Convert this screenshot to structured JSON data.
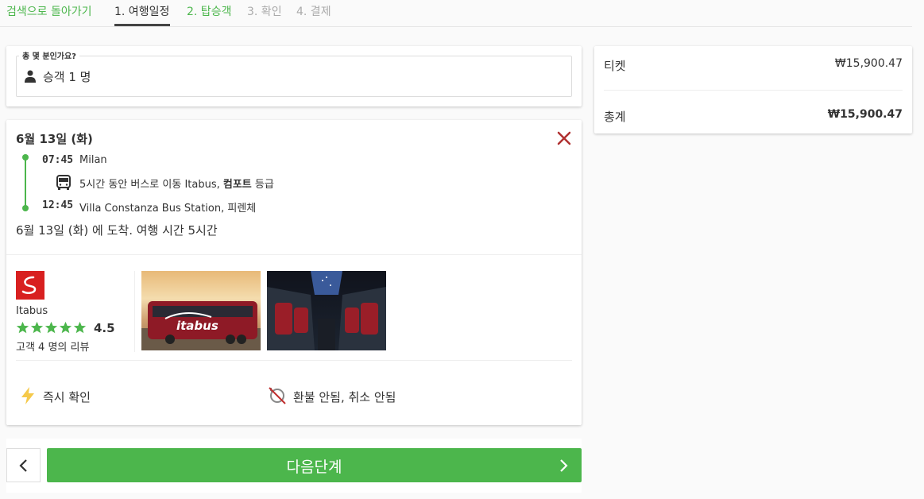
{
  "nav": {
    "back_label": "검색으로 돌아가기",
    "steps": [
      {
        "label": "1. 여행일정"
      },
      {
        "label": "2. 탑승객"
      },
      {
        "label": "3. 확인"
      },
      {
        "label": "4. 결제"
      }
    ]
  },
  "passengers": {
    "legend": "총 몇 분인가요?",
    "value": "승객 1 명"
  },
  "trip": {
    "date": "6월 13일 (화)",
    "departure": {
      "time": "07:45",
      "place": "Milan"
    },
    "segment": {
      "text": "5시간 동안 버스로 이동 Itabus, ",
      "class": "컴포트",
      "suffix": " 등급"
    },
    "arrival": {
      "time": "12:45",
      "place": "Villa Constanza Bus Station, 피렌체"
    },
    "arrival_summary": "6월 13일 (화) 에 도착. 여행 시간 5시간"
  },
  "operator": {
    "name": "Itabus",
    "rating": "4.5",
    "star_count": 5,
    "reviews": "고객 4 명의 리뷰",
    "photo_text": "itabus"
  },
  "features": [
    {
      "label": "즉시 확인",
      "icon": "lightning-icon"
    },
    {
      "label": "환불 안됨, 취소 안됨",
      "icon": "no-refund-icon"
    }
  ],
  "actions": {
    "next_label": "다음단계"
  },
  "summary": {
    "ticket_label": "티켓",
    "ticket_value": "₩15,900.47",
    "total_label": "총계",
    "total_value": "₩15,900.47"
  },
  "colors": {
    "accent": "#4cb64c",
    "close": "#b03030",
    "brand_logo": "#d82020",
    "star": "#4cb64c"
  }
}
